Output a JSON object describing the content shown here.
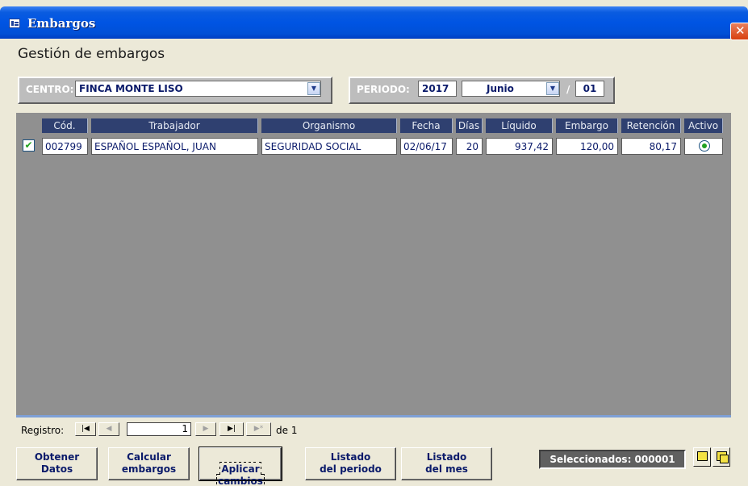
{
  "window": {
    "title": "Embargos",
    "close_label": "✕"
  },
  "page": {
    "heading": "Gestión de embargos"
  },
  "filters": {
    "centro_label": "CENTRO:",
    "centro_value": "FINCA MONTE LISO",
    "periodo_label": "PERIODO:",
    "year": "2017",
    "month": "Junio",
    "separator": "/",
    "number": "01"
  },
  "table": {
    "columns": [
      "Cód.",
      "Trabajador",
      "Organismo",
      "Fecha",
      "Días",
      "Líquido",
      "Embargo",
      "Retención",
      "Activo"
    ],
    "rows": [
      {
        "selected": true,
        "cod": "002799",
        "trabajador": "ESPAÑOL ESPAÑOL, JUAN",
        "organismo": "SEGURIDAD SOCIAL",
        "fecha": "02/06/17",
        "dias": "20",
        "liquido": "937,42",
        "embargo": "120,00",
        "retencion": "80,17",
        "activo": true
      }
    ]
  },
  "navigation": {
    "label": "Registro:",
    "current": "1",
    "of_label": "de 1"
  },
  "buttons": {
    "obtener": "Obtener\nDatos",
    "calcular": "Calcular\nembargos",
    "aplicar": "Aplicar\ncambios",
    "listado_periodo": "Listado\ndel periodo",
    "listado_mes": "Listado\ndel mes"
  },
  "status": {
    "seleccionados": "Seleccionados: 000001"
  },
  "colors": {
    "title_bar": "#0054e3",
    "header": "#2f4070",
    "grid_bg": "#909090",
    "group_bg": "#bdbdbd"
  }
}
